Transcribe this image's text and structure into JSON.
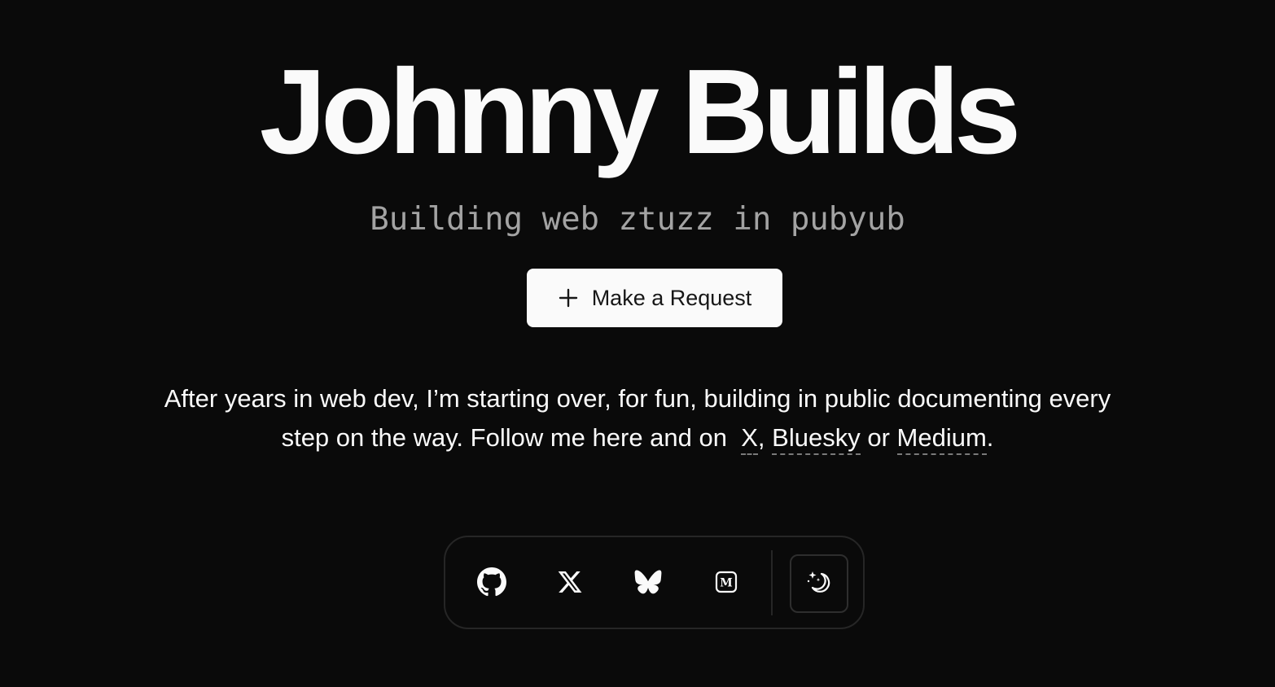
{
  "hero": {
    "title": "Johnny Builds",
    "subtitle": "Building web ztuzz in pubyub"
  },
  "cta": {
    "icon": "plus-icon",
    "label": "Make a Request"
  },
  "intro": {
    "text_line": "After years in web dev, I’m starting over, for fun, building in public documenting every step on the way. Follow me here and on",
    "link_x": "X",
    "comma": ",",
    "link_bluesky": "Bluesky",
    "or": "or",
    "link_medium": "Medium",
    "period": "."
  },
  "dock": {
    "items": [
      {
        "name": "github",
        "icon": "github-icon"
      },
      {
        "name": "x",
        "icon": "x-icon"
      },
      {
        "name": "bluesky",
        "icon": "butterfly-icon"
      },
      {
        "name": "medium",
        "icon": "medium-icon"
      }
    ],
    "theme_toggle_icon": "moon-stars-icon"
  },
  "colors": {
    "background": "#0a0a0a",
    "foreground": "#fafafa",
    "muted": "#a3a3a3",
    "border": "#262626"
  }
}
